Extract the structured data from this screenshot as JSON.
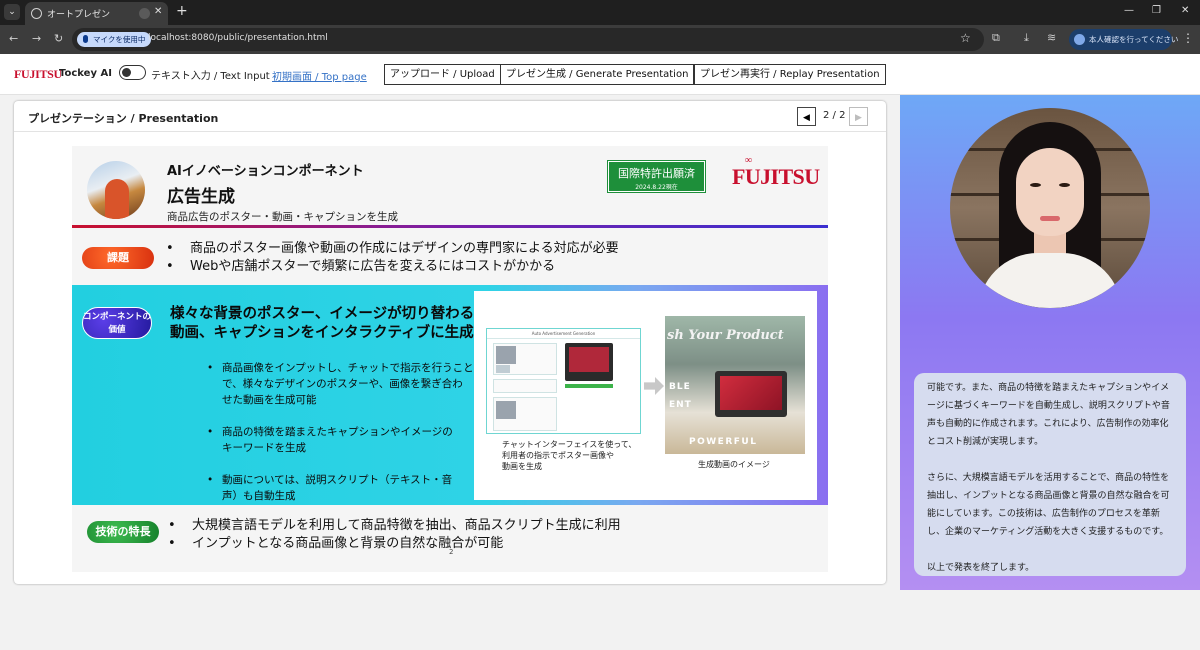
{
  "browser": {
    "tab_title": "オートプレゼン",
    "mic_chip": "マイクを使用中",
    "url": "localhost:8080/public/presentation.html",
    "profile_label": "本人確認を行ってください"
  },
  "header": {
    "logo": "FUJITSU",
    "app_name": "Tockey AI",
    "toggle_label": "テキスト入力 / Text Input",
    "toggle_on": false,
    "top_link": "初期画面 / Top page",
    "buttons": {
      "upload": "アップロード / Upload",
      "generate": "プレゼン生成 / Generate Presentation",
      "replay": "プレゼン再実行 / Replay Presentation"
    }
  },
  "presentation": {
    "title": "プレゼンテーション / Presentation",
    "prev_icon": "◀",
    "next_icon": "▶",
    "page_indicator": "2 / 2",
    "slide": {
      "kicker": "AIイノベーションコンポーネント",
      "title": "広告生成",
      "subtitle": "商品広告のポスター・動画・キャプションを生成",
      "patent_badge": "国際特許出願済",
      "patent_date": "2024.8.22現在",
      "logo": "FUJITSU",
      "issue_label": "課題",
      "issues": [
        "商品のポスター画像や動画の作成にはデザインの専門家による対応が必要",
        "Webや店舗ポスターで頻繁に広告を変えるにはコストがかかる"
      ],
      "value_label_1": "コンポーネントの",
      "value_label_2": "価値",
      "value_headline_1": "様々な背景のポスター、イメージが切り替わる",
      "value_headline_2": "動画、キャプションをインタラクティブに生成",
      "value_points": [
        [
          "商品画像をインプットし、チャットで指示を行うことで、様々なデザインのポスターや、画像を繋ぎ合わせた動画を生成可能"
        ],
        [
          "商品の特徴を踏まえたキャプションやイメージのキーワードを生成"
        ],
        [
          "動画については、説明スクリプト（テキスト・音声）も自動生成"
        ]
      ],
      "value_point_lines": [
        [
          "商品画像をインプットし、チャットで指示を行うこと",
          "で、様々なデザインのポスターや、画像を繋ぎ合わ",
          "せた動画を生成可能"
        ],
        [
          "商品の特徴を踏まえたキャプションやイメージの",
          "キーワードを生成"
        ],
        [
          "動画については、説明スクリプト（テキスト・音",
          "声）も自動生成"
        ]
      ],
      "mock_header": "Auto Advertisement Generation",
      "video_title": "sh Your Product",
      "video_word_1": "BLE",
      "video_word_2": "ENT",
      "video_word_3": "POWERFUL",
      "caption_chat_1": "チャットインターフェイスを使って、",
      "caption_chat_2": "利用者の指示でポスター画像や",
      "caption_chat_3": "動画を生成",
      "caption_video": "生成動画のイメージ",
      "tech_label": "技術の特長",
      "tech_points": [
        "大規模言語モデルを利用して商品特徴を抽出、商品スクリプト生成に利用",
        "インプットとなる商品画像と背景の自然な融合が可能"
      ],
      "page_mark": "2"
    }
  },
  "narration": {
    "text": "可能です。また、商品の特徴を踏まえたキャプションやイメージに基づくキーワードを自動生成し、説明スクリプトや音声も自動的に作成されます。これにより、広告制作の効率化とコスト削減が実現します。\n\nさらに、大規模言語モデルを活用することで、商品の特性を抽出し、インプットとなる商品画像と背景の自然な融合を可能にしています。この技術は、広告制作のプロセスを革新し、企業のマーケティング活動を大きく支援するものです。\n\n以上で発表を終了します。"
  },
  "colors": {
    "brand_red": "#c8102e",
    "issue_pill": "#e8401c",
    "tech_pill": "#1e9a3a",
    "panel_top": "#6ea8f6",
    "panel_bottom": "#b48ff2"
  }
}
